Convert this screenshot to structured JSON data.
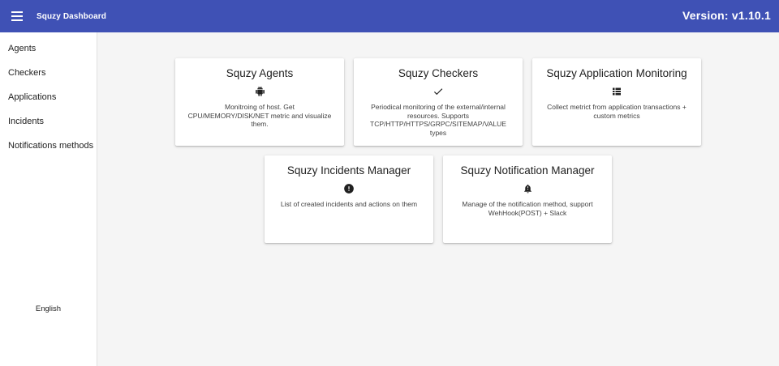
{
  "header": {
    "title": "Squzy Dashboard",
    "version": "Version: v1.10.1",
    "color": "#3f51b5"
  },
  "sidebar": {
    "items": [
      {
        "label": "Agents"
      },
      {
        "label": "Checkers"
      },
      {
        "label": "Applications"
      },
      {
        "label": "Incidents"
      },
      {
        "label": "Notifications methods"
      }
    ],
    "language": "English"
  },
  "cards": [
    {
      "title": "Squzy Agents",
      "icon": "android-icon",
      "description": "Monitroing of host. Get CPU/MEMORY/DISK/NET metric and visualize them."
    },
    {
      "title": "Squzy Checkers",
      "icon": "check-icon",
      "description": "Periodical monitoring of the external/internal resources. Supports TCP/HTTP/HTTPS/GRPC/SITEMAP/VALUE types"
    },
    {
      "title": "Squzy Application Monitoring",
      "icon": "list-icon",
      "description": "Collect metrict from application transactions + custom metrics"
    },
    {
      "title": "Squzy Incidents Manager",
      "icon": "error-icon",
      "description": "List of created incidents and actions on them"
    },
    {
      "title": "Squzy Notification Manager",
      "icon": "notification-bell-icon",
      "description": "Manage of the notification method, support WehHook(POST) + Slack"
    }
  ]
}
